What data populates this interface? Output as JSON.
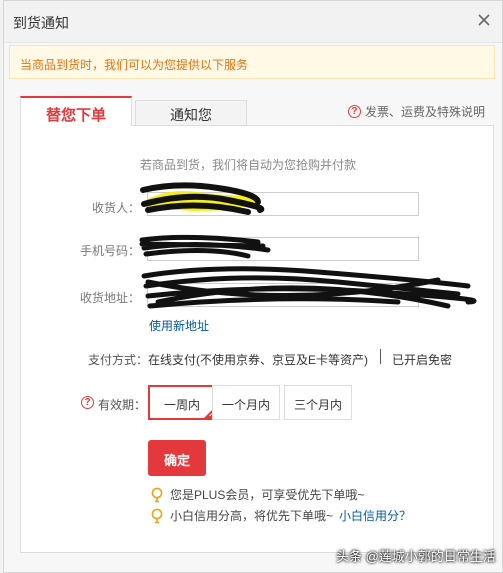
{
  "dialog": {
    "title": "到货通知",
    "notice": "当商品到货时，我们可以为您提供以下服务"
  },
  "tabs": [
    {
      "label": "替您下单",
      "active": true
    },
    {
      "label": "通知您",
      "active": false
    }
  ],
  "help_link": "发票、运费及特殊说明",
  "form": {
    "description": "若商品到货，我们将自动为您抢购并付款",
    "receiver_label": "收货人：",
    "phone_label": "手机号码：",
    "address_label": "收货地址：",
    "new_address_link": "使用新地址",
    "payment_label": "支付方式：",
    "payment_value": "在线支付(不使用京券、京豆及E卡等资产)",
    "payment_extra": "已开启免密",
    "validity_label": "有效期：",
    "validity_options": [
      "一周内",
      "一个月内",
      "三个月内"
    ],
    "validity_selected": "一周内",
    "confirm_label": "确定"
  },
  "tips": {
    "plus": "您是PLUS会员，可享受优先下单哦~",
    "credit_prefix": "小白信用分高，将优先下单哦~",
    "credit_link": "小白信用分？"
  },
  "watermark": "头条 @莲城小郭的日常生活",
  "colors": {
    "accent": "#e4393c",
    "notice_text": "#e4740f",
    "link": "#005aa0",
    "tip_icon": "#f0a31c"
  },
  "icons": {
    "close": "close-icon",
    "help": "question-circle-icon",
    "tip": "lightbulb-icon"
  }
}
